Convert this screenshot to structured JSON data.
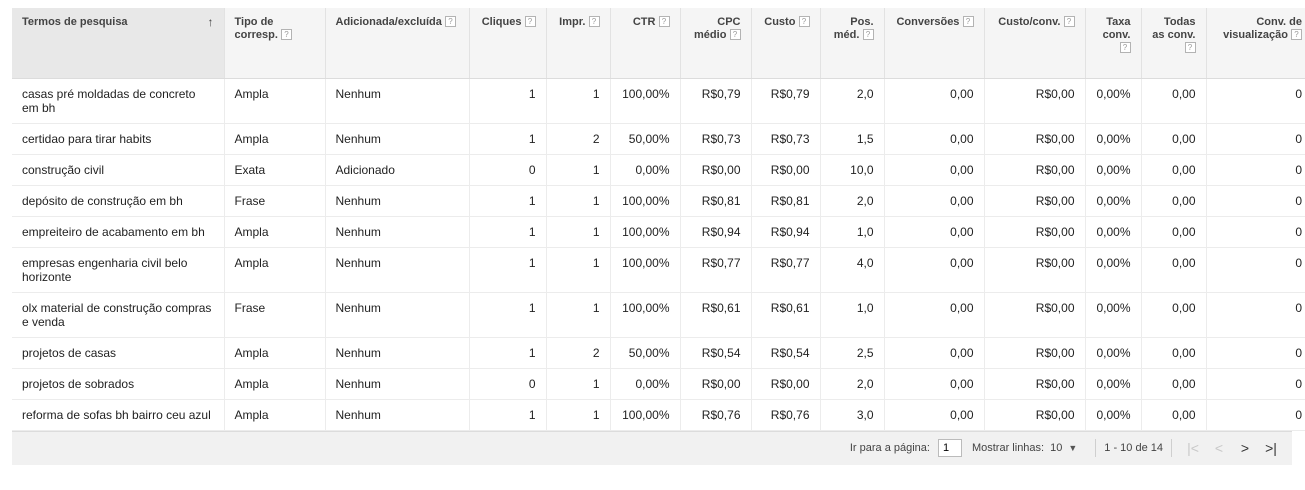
{
  "columns": [
    {
      "label": "Termos de pesquisa",
      "align": "l",
      "sorted": true,
      "help": false
    },
    {
      "label": "Tipo de corresp.",
      "align": "l",
      "help": true
    },
    {
      "label": "Adicionada/excluída",
      "align": "l",
      "help": true
    },
    {
      "label": "Cliques",
      "align": "r",
      "help": true
    },
    {
      "label": "Impr.",
      "align": "r",
      "help": true
    },
    {
      "label": "CTR",
      "align": "r",
      "help": true
    },
    {
      "label": "CPC médio",
      "align": "r",
      "help": true
    },
    {
      "label": "Custo",
      "align": "r",
      "help": true
    },
    {
      "label": "Pos. méd.",
      "align": "r",
      "help": true
    },
    {
      "label": "Conversões",
      "align": "r",
      "help": true
    },
    {
      "label": "Custo/conv.",
      "align": "r",
      "help": true
    },
    {
      "label": "Taxa conv.",
      "align": "r",
      "help": true
    },
    {
      "label": "Todas as conv.",
      "align": "r",
      "help": true
    },
    {
      "label": "Conv. de visualização",
      "align": "r",
      "help": true
    }
  ],
  "sort_icon": "arrow-up-icon",
  "help_glyph": "?",
  "rows": [
    [
      "casas pré moldadas de concreto em bh",
      "Ampla",
      "Nenhum",
      "1",
      "1",
      "100,00%",
      "R$0,79",
      "R$0,79",
      "2,0",
      "0,00",
      "R$0,00",
      "0,00%",
      "0,00",
      "0"
    ],
    [
      "certidao para tirar habits",
      "Ampla",
      "Nenhum",
      "1",
      "2",
      "50,00%",
      "R$0,73",
      "R$0,73",
      "1,5",
      "0,00",
      "R$0,00",
      "0,00%",
      "0,00",
      "0"
    ],
    [
      "construção civil",
      "Exata",
      "Adicionado",
      "0",
      "1",
      "0,00%",
      "R$0,00",
      "R$0,00",
      "10,0",
      "0,00",
      "R$0,00",
      "0,00%",
      "0,00",
      "0"
    ],
    [
      "depósito de construção em bh",
      "Frase",
      "Nenhum",
      "1",
      "1",
      "100,00%",
      "R$0,81",
      "R$0,81",
      "2,0",
      "0,00",
      "R$0,00",
      "0,00%",
      "0,00",
      "0"
    ],
    [
      "empreiteiro de acabamento em bh",
      "Ampla",
      "Nenhum",
      "1",
      "1",
      "100,00%",
      "R$0,94",
      "R$0,94",
      "1,0",
      "0,00",
      "R$0,00",
      "0,00%",
      "0,00",
      "0"
    ],
    [
      "empresas engenharia civil belo horizonte",
      "Ampla",
      "Nenhum",
      "1",
      "1",
      "100,00%",
      "R$0,77",
      "R$0,77",
      "4,0",
      "0,00",
      "R$0,00",
      "0,00%",
      "0,00",
      "0"
    ],
    [
      "olx material de construção compras e venda",
      "Frase",
      "Nenhum",
      "1",
      "1",
      "100,00%",
      "R$0,61",
      "R$0,61",
      "1,0",
      "0,00",
      "R$0,00",
      "0,00%",
      "0,00",
      "0"
    ],
    [
      "projetos de casas",
      "Ampla",
      "Nenhum",
      "1",
      "2",
      "50,00%",
      "R$0,54",
      "R$0,54",
      "2,5",
      "0,00",
      "R$0,00",
      "0,00%",
      "0,00",
      "0"
    ],
    [
      "projetos de sobrados",
      "Ampla",
      "Nenhum",
      "0",
      "1",
      "0,00%",
      "R$0,00",
      "R$0,00",
      "2,0",
      "0,00",
      "R$0,00",
      "0,00%",
      "0,00",
      "0"
    ],
    [
      "reforma de sofas bh bairro ceu azul",
      "Ampla",
      "Nenhum",
      "1",
      "1",
      "100,00%",
      "R$0,76",
      "R$0,76",
      "3,0",
      "0,00",
      "R$0,00",
      "0,00%",
      "0,00",
      "0"
    ]
  ],
  "footer": {
    "go_to_page_label": "Ir para a página:",
    "page_value": "1",
    "show_rows_label": "Mostrar linhas:",
    "rows_value": "10",
    "range_text": "1 - 10 de 14",
    "nav_first": "|<",
    "nav_prev": "<",
    "nav_next": ">",
    "nav_last": ">|"
  }
}
